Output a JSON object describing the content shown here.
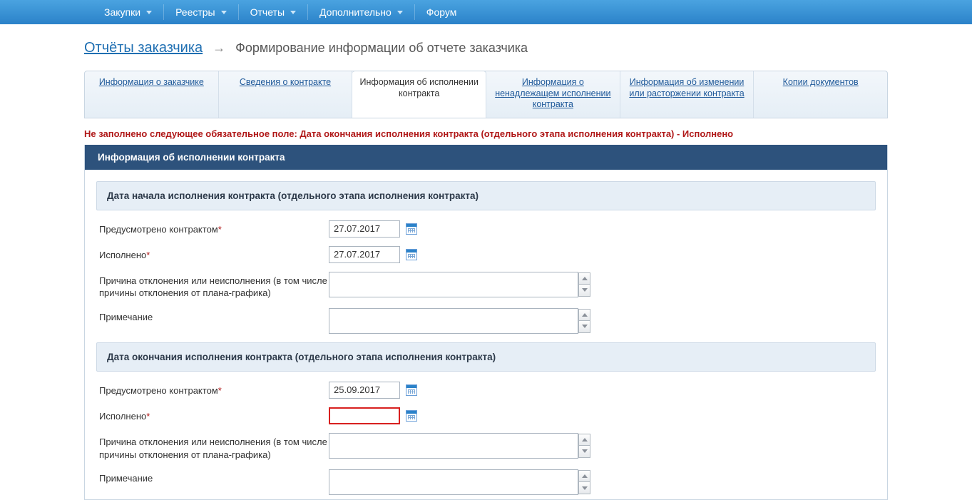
{
  "topnav": {
    "items": [
      {
        "label": "Закупки",
        "has_dropdown": true
      },
      {
        "label": "Реестры",
        "has_dropdown": true
      },
      {
        "label": "Отчеты",
        "has_dropdown": true
      },
      {
        "label": "Дополнительно",
        "has_dropdown": true
      },
      {
        "label": "Форум",
        "has_dropdown": false
      }
    ]
  },
  "breadcrumb": {
    "root": "Отчёты заказчика",
    "current": "Формирование информации об отчете заказчика"
  },
  "tabs": [
    {
      "label": "Информация о заказчике",
      "active": false
    },
    {
      "label": "Сведения о контракте",
      "active": false
    },
    {
      "label": "Информация об исполнении контракта",
      "active": true
    },
    {
      "label": "Информация о ненадлежащем исполнении контракта",
      "active": false
    },
    {
      "label": "Информация об изменении или расторжении контракта",
      "active": false
    },
    {
      "label": "Копии документов",
      "active": false
    }
  ],
  "error_message": "Не заполнено следующее обязательное поле: Дата окончания исполнения контракта (отдельного этапа исполнения контракта) - Исполнено",
  "section_title": "Информация об исполнении контракта",
  "groups": {
    "start": {
      "title": "Дата начала исполнения контракта (отдельного этапа исполнения контракта)",
      "rows": {
        "planned": {
          "label": "Предусмотрено контрактом",
          "required": true,
          "value": "27.07.2017"
        },
        "done": {
          "label": "Исполнено",
          "required": true,
          "value": "27.07.2017"
        },
        "reason": {
          "label": "Причина отклонения или неисполнения (в том числе причины отклонения от плана-графика)",
          "value": ""
        },
        "note": {
          "label": "Примечание",
          "value": ""
        }
      }
    },
    "end": {
      "title": "Дата окончания исполнения контракта (отдельного этапа исполнения контракта)",
      "rows": {
        "planned": {
          "label": "Предусмотрено контрактом",
          "required": true,
          "value": "25.09.2017"
        },
        "done": {
          "label": "Исполнено",
          "required": true,
          "value": "",
          "error": true
        },
        "reason": {
          "label": "Причина отклонения или неисполнения (в том числе причины отклонения от плана-графика)",
          "value": ""
        },
        "note": {
          "label": "Примечание",
          "value": ""
        }
      }
    }
  },
  "asterisk": "*"
}
